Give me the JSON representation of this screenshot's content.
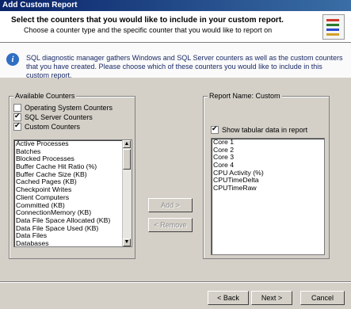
{
  "window": {
    "title": "Add Custom Report"
  },
  "header": {
    "heading": "Select the counters that you would like to include in your custom report.",
    "subheading": "Choose a counter type and the specific counter that you would like to report on"
  },
  "info": {
    "icon": "info-icon",
    "text": "SQL diagnostic manager gathers Windows and SQL Server counters as well as the custom counters that you have created.  Please choose which of these counters you would like to include in this custom report."
  },
  "available": {
    "legend": "Available Counters",
    "checkboxes": [
      {
        "label": "Operating System Counters",
        "checked": false
      },
      {
        "label": "SQL Server Counters",
        "checked": true
      },
      {
        "label": "Custom Counters",
        "checked": true
      }
    ],
    "items": [
      "Active Processes",
      "Batches",
      "Blocked Processes",
      "Buffer Cache Hit Ratio (%)",
      "Buffer Cache Size (KB)",
      "Cached Pages (KB)",
      "Checkpoint Writes",
      "Client Computers",
      "Committed (KB)",
      "ConnectionMemory (KB)",
      "Data File Space Allocated (KB)",
      "Data File Space Used (KB)",
      "Data Files",
      "Databases"
    ]
  },
  "actions": {
    "add": "Add >",
    "remove": "< Remove"
  },
  "report": {
    "legend": "Report Name: Custom",
    "show_tabular": {
      "label": "Show tabular data in report",
      "checked": true
    },
    "items": [
      "Core 1",
      "Core 2",
      "Core 3",
      "Core 4",
      "CPU Activity (%)",
      "CPUTimeDelta",
      "CPUTimeRaw"
    ]
  },
  "footer": {
    "back": "< Back",
    "next": "Next >",
    "cancel": "Cancel"
  }
}
